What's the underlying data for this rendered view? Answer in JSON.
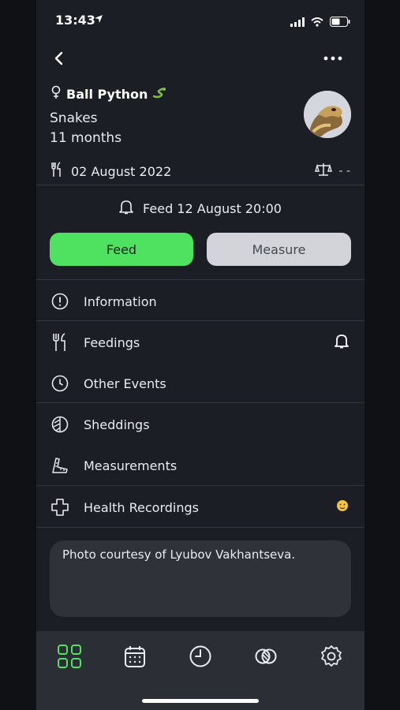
{
  "status": {
    "time": "13:43"
  },
  "pet": {
    "name": "Ball Python",
    "species": "Snakes",
    "age": "11 months",
    "last_fed": "02 August 2022",
    "weight": "- -"
  },
  "reminder": {
    "text": "Feed 12 August 20:00"
  },
  "actions": {
    "feed_label": "Feed",
    "measure_label": "Measure"
  },
  "menu": [
    {
      "label": "Information",
      "icon": "info-icon"
    },
    {
      "label": "Feedings",
      "icon": "fork-knife-icon"
    },
    {
      "label": "Other Events",
      "icon": "clock-icon"
    },
    {
      "label": "Sheddings",
      "icon": "shedding-icon"
    },
    {
      "label": "Measurements",
      "icon": "ruler-icon"
    },
    {
      "label": "Health Recordings",
      "icon": "plus-icon"
    }
  ],
  "note": {
    "text": "Photo courtesy of Lyubov Vakhantseva."
  },
  "tabbar": [
    "grid-icon",
    "calendar-icon",
    "history-icon",
    "interlink-icon",
    "settings-icon"
  ],
  "colors": {
    "accent": "#4fe261",
    "background": "#1b1e24",
    "tabbar": "#2b2e35"
  }
}
